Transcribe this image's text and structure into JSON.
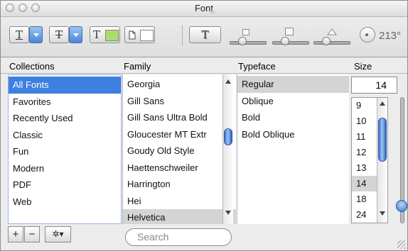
{
  "window": {
    "title": "Font"
  },
  "toolbar": {
    "underline_glyph": "T",
    "strikethrough_glyph": "T",
    "text_color_glyph": "T",
    "text_color_swatch": "#a8dd70",
    "document_color_swatch": "#ffffff",
    "shadow_glyph": "T",
    "angle_label": "213°"
  },
  "headers": {
    "collections": "Collections",
    "family": "Family",
    "typeface": "Typeface",
    "size": "Size"
  },
  "collections": [
    "All Fonts",
    "Favorites",
    "Recently Used",
    "Classic",
    "Fun",
    "Modern",
    "PDF",
    "Web"
  ],
  "selected_collection": "All Fonts",
  "families": [
    "Georgia",
    "Gill Sans",
    "Gill Sans Ultra Bold",
    "Gloucester MT Extr",
    "Goudy Old Style",
    "Haettenschweiler",
    "Harrington",
    "Hei",
    "Helvetica"
  ],
  "selected_family": "Helvetica",
  "typefaces": [
    "Regular",
    "Oblique",
    "Bold",
    "Bold Oblique"
  ],
  "selected_typeface": "Regular",
  "size": {
    "value": "14",
    "options": [
      "9",
      "10",
      "11",
      "12",
      "13",
      "14",
      "18",
      "24"
    ],
    "selected": "14"
  },
  "bottom": {
    "add_label": "+",
    "remove_label": "−",
    "action_glyph": "✲▾",
    "search_placeholder": "Search"
  },
  "colors": {
    "selection_blue": "#3d80df",
    "selection_gray": "#d4d4d4",
    "scroll_thumb": "#4a86d6"
  }
}
